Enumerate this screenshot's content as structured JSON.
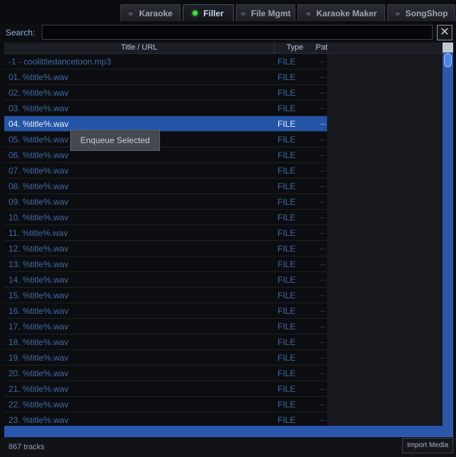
{
  "tabs": [
    {
      "label": "Karaoke",
      "active": false
    },
    {
      "label": "Filler",
      "active": true
    },
    {
      "label": "File Mgmt",
      "active": false
    },
    {
      "label": "Karaoke Maker",
      "active": false
    },
    {
      "label": "SongShop",
      "active": false
    }
  ],
  "search": {
    "label": "Search:",
    "value": "",
    "clear_icon": "close-icon"
  },
  "table": {
    "columns": [
      "Title / URL",
      "Type",
      "Pat"
    ],
    "rows": [
      {
        "title": "-1 - coolittledancetoon.mp3",
        "type": "FILE",
        "path": "..."
      },
      {
        "title": "01. %title%.wav",
        "type": "FILE",
        "path": "..."
      },
      {
        "title": "02. %title%.wav",
        "type": "FILE",
        "path": "..."
      },
      {
        "title": "03. %title%.wav",
        "type": "FILE",
        "path": "..."
      },
      {
        "title": "04. %title%.wav",
        "type": "FILE",
        "path": "...",
        "selected": true
      },
      {
        "title": "05. %title%.wav",
        "type": "FILE",
        "path": "..."
      },
      {
        "title": "06. %title%.wav",
        "type": "FILE",
        "path": "..."
      },
      {
        "title": "07. %title%.wav",
        "type": "FILE",
        "path": "..."
      },
      {
        "title": "08. %title%.wav",
        "type": "FILE",
        "path": "..."
      },
      {
        "title": "09. %title%.wav",
        "type": "FILE",
        "path": "..."
      },
      {
        "title": "10. %title%.wav",
        "type": "FILE",
        "path": "..."
      },
      {
        "title": "11. %title%.wav",
        "type": "FILE",
        "path": "..."
      },
      {
        "title": "12. %title%.wav",
        "type": "FILE",
        "path": "..."
      },
      {
        "title": "13. %title%.wav",
        "type": "FILE",
        "path": "..."
      },
      {
        "title": "14. %title%.wav",
        "type": "FILE",
        "path": "..."
      },
      {
        "title": "15. %title%.wav",
        "type": "FILE",
        "path": "..."
      },
      {
        "title": "16. %title%.wav",
        "type": "FILE",
        "path": "..."
      },
      {
        "title": "17. %title%.wav",
        "type": "FILE",
        "path": "..."
      },
      {
        "title": "18. %title%.wav",
        "type": "FILE",
        "path": "..."
      },
      {
        "title": "19. %title%.wav",
        "type": "FILE",
        "path": "..."
      },
      {
        "title": "20. %title%.wav",
        "type": "FILE",
        "path": "..."
      },
      {
        "title": "21. %title%.wav",
        "type": "FILE",
        "path": "..."
      },
      {
        "title": "22. %title%.wav",
        "type": "FILE",
        "path": "..."
      },
      {
        "title": "23. %title%.wav",
        "type": "FILE",
        "path": "..."
      }
    ]
  },
  "context_menu": {
    "items": [
      "Enqueue Selected"
    ]
  },
  "status": {
    "track_count": "867 tracks",
    "import_label": "Import Media"
  },
  "colors": {
    "accent": "#2454a6",
    "active_indicator": "#3ee63e"
  }
}
